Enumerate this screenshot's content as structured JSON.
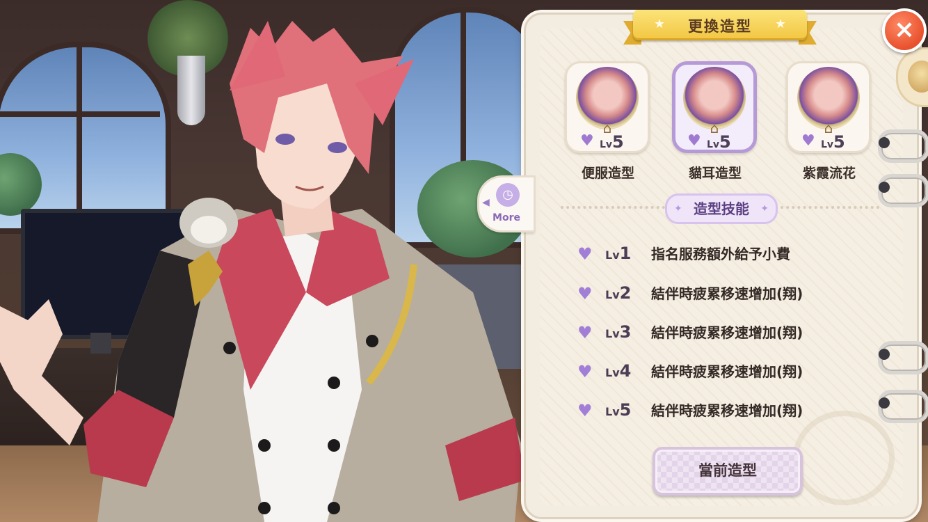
{
  "panel": {
    "title": "更換造型",
    "close_icon": "×"
  },
  "outfits": [
    {
      "name": "便服造型",
      "level_prefix": "Lv",
      "level": "5",
      "selected": false
    },
    {
      "name": "貓耳造型",
      "level_prefix": "Lv",
      "level": "5",
      "selected": true
    },
    {
      "name": "紫霞流花",
      "level_prefix": "Lv",
      "level": "5",
      "selected": false
    }
  ],
  "more_tab": {
    "label": "More",
    "icon": "clock-icon"
  },
  "skills": {
    "header": "造型技能",
    "items": [
      {
        "level_prefix": "Lv",
        "level": "1",
        "desc": "指名服務額外給予小費"
      },
      {
        "level_prefix": "Lv",
        "level": "2",
        "desc": "結伴時疲累移速增加(翔)"
      },
      {
        "level_prefix": "Lv",
        "level": "3",
        "desc": "結伴時疲累移速增加(翔)"
      },
      {
        "level_prefix": "Lv",
        "level": "4",
        "desc": "結伴時疲累移速增加(翔)"
      },
      {
        "level_prefix": "Lv",
        "level": "5",
        "desc": "結伴時疲累移速增加(翔)"
      }
    ]
  },
  "current_button": {
    "label": "當前造型"
  },
  "colors": {
    "accent_purple": "#b69ad8",
    "close_orange": "#e8512d",
    "banner_gold": "#f2c540",
    "panel_bg": "#f5eee2"
  }
}
